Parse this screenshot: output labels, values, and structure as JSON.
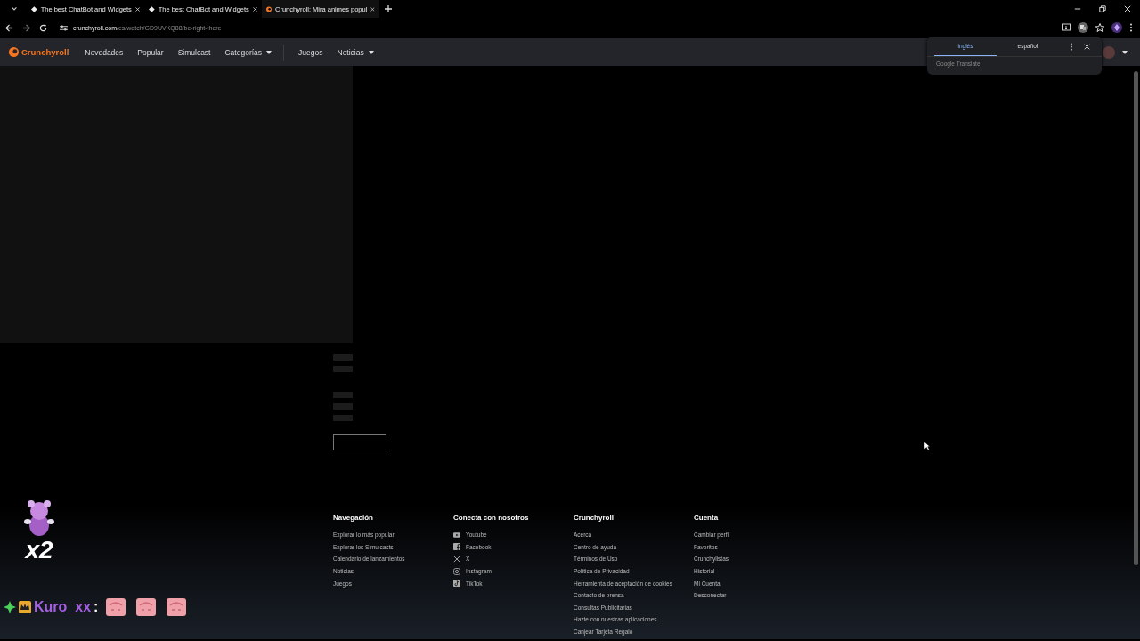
{
  "browser": {
    "tabs": [
      {
        "title": "The best ChatBot and Widgets",
        "selected": false,
        "kind": "chatbot"
      },
      {
        "title": "The best ChatBot and Widgets",
        "selected": false,
        "kind": "chatbot"
      },
      {
        "title": "Crunchyroll: Mira animes popul",
        "selected": true,
        "kind": "crunchyroll"
      }
    ],
    "url": {
      "host": "crunchyroll.com",
      "path": "/es/watch/GD9UVKQ88/be-right-there"
    }
  },
  "site_nav": {
    "logo": "Crunchyroll",
    "items": [
      {
        "label": "Novedades",
        "dropdown": false
      },
      {
        "label": "Popular",
        "dropdown": false
      },
      {
        "label": "Simulcast",
        "dropdown": false
      },
      {
        "label": "Categorías",
        "dropdown": true
      },
      {
        "label": "Juegos",
        "dropdown": false
      },
      {
        "label": "Noticias",
        "dropdown": true
      }
    ]
  },
  "translate_popup": {
    "languages": [
      {
        "label": "inglés",
        "selected": true
      },
      {
        "label": "español",
        "selected": false
      }
    ],
    "footer": "Google Translate"
  },
  "footer": {
    "columns": [
      {
        "heading": "Navegación",
        "links": [
          {
            "label": "Explorar lo más popular"
          },
          {
            "label": "Explorar los Simulcasts"
          },
          {
            "label": "Calendario de lanzamientos"
          },
          {
            "label": "Noticias"
          },
          {
            "label": "Juegos"
          }
        ]
      },
      {
        "heading": "Conecta con nosotros",
        "links": [
          {
            "label": "Youtube"
          },
          {
            "label": "Facebook"
          },
          {
            "label": "X"
          },
          {
            "label": "Instagram"
          },
          {
            "label": "TikTok"
          }
        ]
      },
      {
        "heading": "Crunchyroll",
        "links": [
          {
            "label": "Acerca"
          },
          {
            "label": "Centro de ayuda"
          },
          {
            "label": "Términos de Uso"
          },
          {
            "label": "Política de Privacidad"
          },
          {
            "label": "Herramienta de aceptación de cookies"
          },
          {
            "label": "Contacto de prensa"
          },
          {
            "label": "Consultas Publicitarias"
          },
          {
            "label": "Hazte con nuestras aplicaciones"
          },
          {
            "label": "Canjear Tarjeta Regalo"
          }
        ]
      },
      {
        "heading": "Cuenta",
        "links": [
          {
            "label": "Cambiar perfil"
          },
          {
            "label": "Favoritos"
          },
          {
            "label": "Crunchylistas"
          },
          {
            "label": "Historial"
          },
          {
            "label": "Mi Cuenta"
          },
          {
            "label": "Desconectar"
          }
        ]
      }
    ]
  },
  "stream_overlay": {
    "alert_multiplier": "x2",
    "chat": {
      "username": "Kuro_xx",
      "separator": ":",
      "emotes": [
        {
          "kind": "emote"
        },
        {
          "kind": "emote"
        },
        {
          "kind": "emote"
        }
      ]
    }
  }
}
